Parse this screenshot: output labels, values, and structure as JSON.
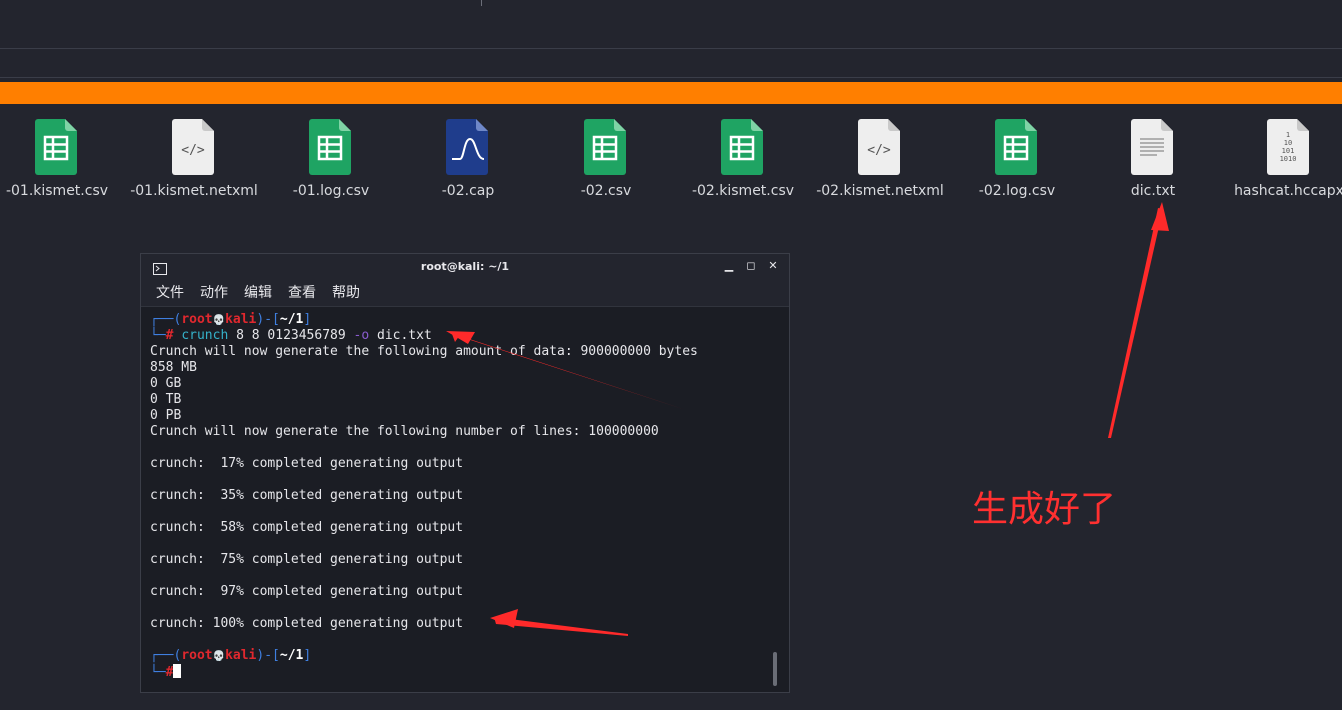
{
  "files": [
    {
      "name": "-01.kismet.csv",
      "icon": "spreadsheet-icon"
    },
    {
      "name": "-01.kismet.netxml",
      "icon": "code-file-icon"
    },
    {
      "name": "-01.log.csv",
      "icon": "spreadsheet-icon"
    },
    {
      "name": "-02.cap",
      "icon": "wireshark-capture-icon"
    },
    {
      "name": "-02.csv",
      "icon": "spreadsheet-icon"
    },
    {
      "name": "-02.kismet.csv",
      "icon": "spreadsheet-icon"
    },
    {
      "name": "-02.kismet.netxml",
      "icon": "code-file-icon"
    },
    {
      "name": "-02.log.csv",
      "icon": "spreadsheet-icon"
    },
    {
      "name": "dic.txt",
      "icon": "text-file-icon"
    },
    {
      "name": "hashcat.hccapx",
      "icon": "binary-file-icon"
    }
  ],
  "terminal": {
    "title": "root@kali: ~/1",
    "menu": [
      "文件",
      "动作",
      "编辑",
      "查看",
      "帮助"
    ],
    "prompt": {
      "user": "root",
      "host": "kali",
      "dir": "~/1",
      "skull": "💀",
      "hash": "#"
    },
    "command": {
      "program": "crunch",
      "args": "8 8 0123456789",
      "option": "-o",
      "file": "dic.txt"
    },
    "output": [
      "Crunch will now generate the following amount of data: 900000000 bytes",
      "858 MB",
      "0 GB",
      "0 TB",
      "0 PB",
      "Crunch will now generate the following number of lines: 100000000",
      "",
      "crunch:  17% completed generating output",
      "",
      "crunch:  35% completed generating output",
      "",
      "crunch:  58% completed generating output",
      "",
      "crunch:  75% completed generating output",
      "",
      "crunch:  97% completed generating output",
      "",
      "crunch: 100% completed generating output",
      ""
    ]
  },
  "annotation": {
    "text": "生成好了",
    "color": "#ff3030"
  },
  "colors": {
    "accent_bar": "#ff7f00",
    "background": "#23252e",
    "spreadsheet": "#1fa463",
    "capture": "#1f3d8c"
  }
}
